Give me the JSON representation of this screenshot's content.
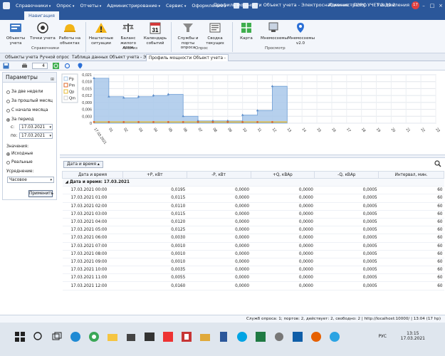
{
  "titlebar": {
    "menu": [
      "Справочники",
      "Опрос",
      "Отчеты",
      "Администрирование",
      "Сервис",
      "Оформление"
    ],
    "window_title": "Профиль мощности Объект учета - Электроснабжение - ПЭРС УЧЕТ 3.39.2",
    "user": "Администратор",
    "notifications_label": "Уведомления",
    "notifications_count": "17"
  },
  "ribbon": {
    "active_tab": "Навигация",
    "buttons": [
      {
        "label": "Объекты учета"
      },
      {
        "label": "Точки учета"
      },
      {
        "label": "Работы на объектах"
      },
      {
        "label": "Нештатные ситуации"
      },
      {
        "label": "Баланс жилого дома"
      },
      {
        "label": "Календарь событий"
      },
      {
        "label": "Службы и порты опроса"
      },
      {
        "label": "Сводка текущих"
      },
      {
        "label": "Карта"
      },
      {
        "label": "Мнемосхемы"
      },
      {
        "label": "Мнемосхемы v2.0"
      }
    ],
    "calendar_day": "31",
    "groups": [
      "Справочники",
      "Анализ",
      "Опрос",
      "Просмотр"
    ]
  },
  "doc_tabs": [
    "Объекты учета",
    "Ручной опрос",
    "Таблица данных Объект учета - Элект",
    "Профиль мощности Объект учета -"
  ],
  "toolbar": {
    "step_value": "4"
  },
  "params": {
    "title": "Параметры",
    "period_options": [
      "За две недели",
      "За прошлый месяц",
      "С начала месяца",
      "За период"
    ],
    "selected_period": "За период",
    "from_label": "с:",
    "to_label": "по:",
    "from_date": "17.03.2021",
    "to_date": "17.03.2021",
    "values_label": "Значения:",
    "value_options": [
      "Исходные",
      "Реальные"
    ],
    "averaging_label": "Усреднение:",
    "averaging_value": "Часовое",
    "apply_label": "Применить"
  },
  "chart_data": {
    "type": "area",
    "series": [
      {
        "name": "Pp",
        "color": "#a9c8ea",
        "values": [
          0.0195,
          0.0115,
          0.011,
          0.0115,
          0.012,
          0.0125,
          0.003,
          0.001,
          0.001,
          0.001,
          0.0035,
          0.0055,
          0.016
        ]
      },
      {
        "name": "Pm",
        "color": "#e0682a",
        "values": [
          0,
          0,
          0,
          0,
          0,
          0,
          0,
          0,
          0,
          0,
          0,
          0,
          0
        ]
      },
      {
        "name": "Qp",
        "color": "#e6b830",
        "values": [
          0.0005,
          0.0005,
          0.0005,
          0.0005,
          0.0005,
          0.0005,
          0.0005,
          0.0005,
          0.0005,
          0.0005,
          0.0005,
          0.0005,
          0.0005
        ]
      },
      {
        "name": "Qm",
        "color": "#cfcfcf",
        "values": [
          0,
          0,
          0,
          0,
          0,
          0,
          0,
          0,
          0,
          0,
          0,
          0,
          0
        ]
      }
    ],
    "x_labels": [
      "17.03.2021",
      "01",
      "02",
      "03",
      "04",
      "05",
      "06",
      "07",
      "08",
      "09",
      "10",
      "11",
      "12",
      "13",
      "14",
      "15",
      "16",
      "17",
      "18",
      "19",
      "20",
      "21",
      "22",
      "23"
    ],
    "y_ticks": [
      "0,021",
      "0,018",
      "0,015",
      "0,012",
      "0,009",
      "0,006",
      "0,003",
      "0"
    ],
    "ylim": [
      0,
      0.021
    ],
    "grid": true,
    "legend_position": "top-left"
  },
  "grid": {
    "group_by_label": "Дата и время",
    "columns": [
      "Дата и время",
      "+P, кВт",
      "-P, кВт",
      "+Q, кВАр",
      "-Q, кВАр",
      "Интервал, мин."
    ],
    "group_row": "Дата и время: 17.03.2021",
    "rows": [
      [
        "17.03.2021 00:00",
        "0,0195",
        "0,0000",
        "0,0000",
        "0,0005",
        "60"
      ],
      [
        "17.03.2021 01:00",
        "0,0115",
        "0,0000",
        "0,0000",
        "0,0005",
        "60"
      ],
      [
        "17.03.2021 02:00",
        "0,0110",
        "0,0000",
        "0,0000",
        "0,0005",
        "60"
      ],
      [
        "17.03.2021 03:00",
        "0,0115",
        "0,0000",
        "0,0000",
        "0,0005",
        "60"
      ],
      [
        "17.03.2021 04:00",
        "0,0120",
        "0,0000",
        "0,0000",
        "0,0005",
        "60"
      ],
      [
        "17.03.2021 05:00",
        "0,0125",
        "0,0000",
        "0,0000",
        "0,0005",
        "60"
      ],
      [
        "17.03.2021 06:00",
        "0,0030",
        "0,0000",
        "0,0000",
        "0,0005",
        "60"
      ],
      [
        "17.03.2021 07:00",
        "0,0010",
        "0,0000",
        "0,0000",
        "0,0005",
        "60"
      ],
      [
        "17.03.2021 08:00",
        "0,0010",
        "0,0000",
        "0,0000",
        "0,0005",
        "60"
      ],
      [
        "17.03.2021 09:00",
        "0,0010",
        "0,0000",
        "0,0000",
        "0,0005",
        "60"
      ],
      [
        "17.03.2021 10:00",
        "0,0035",
        "0,0000",
        "0,0000",
        "0,0005",
        "60"
      ],
      [
        "17.03.2021 11:00",
        "0,0055",
        "0,0000",
        "0,0000",
        "0,0005",
        "60"
      ],
      [
        "17.03.2021 12:00",
        "0,0160",
        "0,0000",
        "0,0000",
        "0,0005",
        "60"
      ]
    ]
  },
  "status": {
    "text": "Служб опроса: 1; портов: 2, действует: 2, свободно: 2  |  http://localhost:10000/  |  13:04 (17 hp)"
  },
  "taskbar": {
    "lang": "РУС",
    "time": "13:15",
    "date": "17.03.2021"
  },
  "colors": {
    "accent": "#2b579a",
    "series_pp": "#a9c8ea",
    "series_pm": "#e0682a",
    "series_qp": "#e6b830"
  }
}
